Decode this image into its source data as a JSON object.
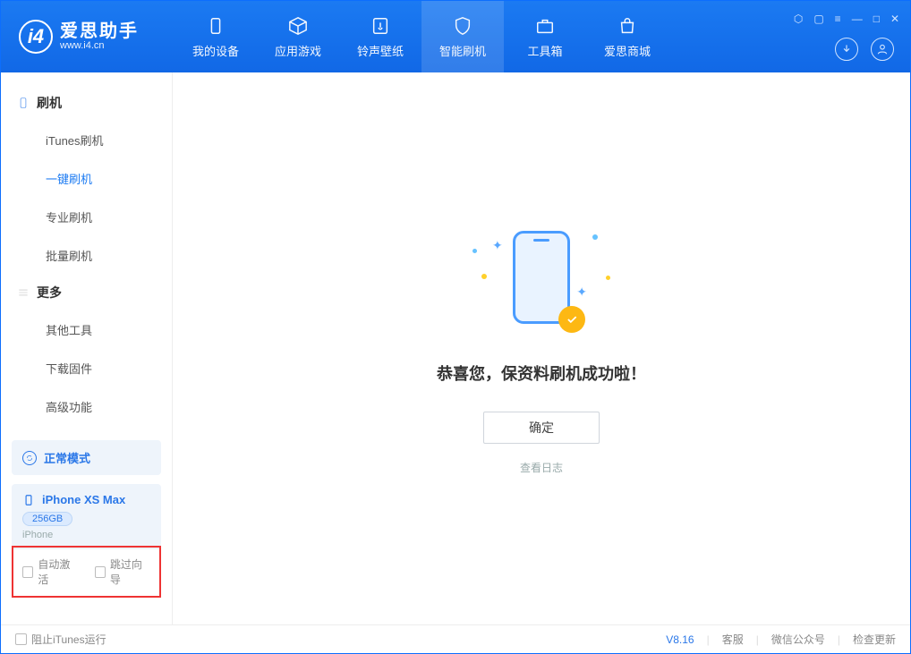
{
  "app": {
    "name": "爱思助手",
    "url": "www.i4.cn"
  },
  "nav": {
    "device": "我的设备",
    "apps": "应用游戏",
    "ring": "铃声壁纸",
    "flash": "智能刷机",
    "toolbox": "工具箱",
    "store": "爱思商城"
  },
  "sidebar": {
    "sec1": "刷机",
    "items1": {
      "itunes": "iTunes刷机",
      "oneclick": "一键刷机",
      "pro": "专业刷机",
      "batch": "批量刷机"
    },
    "sec2": "更多",
    "items2": {
      "other": "其他工具",
      "fw": "下载固件",
      "adv": "高级功能"
    }
  },
  "device": {
    "mode": "正常模式",
    "name": "iPhone XS Max",
    "capacity": "256GB",
    "type": "iPhone"
  },
  "options": {
    "auto_activate": "自动激活",
    "skip_guide": "跳过向导"
  },
  "main": {
    "success_msg": "恭喜您，保资料刷机成功啦！",
    "ok": "确定",
    "log": "查看日志"
  },
  "footer": {
    "block_itunes": "阻止iTunes运行",
    "version": "V8.16",
    "support": "客服",
    "wechat": "微信公众号",
    "update": "检查更新"
  }
}
